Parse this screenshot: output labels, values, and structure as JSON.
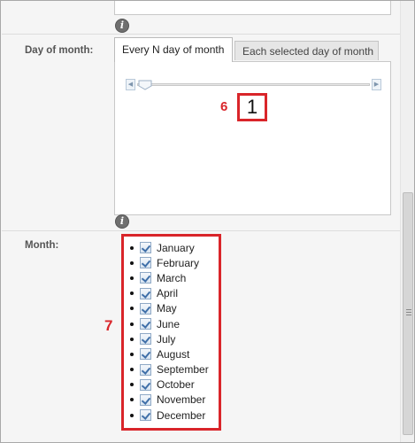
{
  "fields": {
    "day_of_month": {
      "label": "Day of month:",
      "tabs": [
        {
          "label": "Every N day of month",
          "active": true
        },
        {
          "label": "Each selected day of month",
          "active": false
        }
      ],
      "slider": {
        "value": 1,
        "min": 1,
        "left_arrow": "◀",
        "right_arrow": "▶"
      },
      "value_display": "1"
    },
    "month": {
      "label": "Month:",
      "options": [
        {
          "label": "January",
          "checked": true
        },
        {
          "label": "February",
          "checked": true
        },
        {
          "label": "March",
          "checked": true
        },
        {
          "label": "April",
          "checked": true
        },
        {
          "label": "May",
          "checked": true
        },
        {
          "label": "June",
          "checked": true
        },
        {
          "label": "July",
          "checked": true
        },
        {
          "label": "August",
          "checked": true
        },
        {
          "label": "September",
          "checked": true
        },
        {
          "label": "October",
          "checked": true
        },
        {
          "label": "November",
          "checked": true
        },
        {
          "label": "December",
          "checked": true
        }
      ]
    }
  },
  "annotations": {
    "day_of_month_marker": "6",
    "month_marker": "7"
  },
  "icons": {
    "info": "i"
  },
  "colors": {
    "annotation_red": "#d9252a",
    "checkbox_blue": "#3f6fa8"
  }
}
